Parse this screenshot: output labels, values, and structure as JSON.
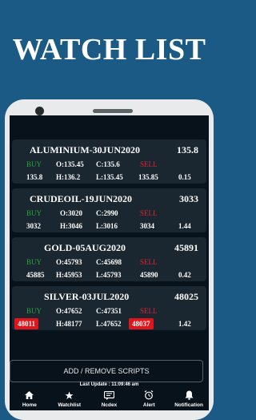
{
  "banner_title": "WATCH LIST",
  "scripts": [
    {
      "name": "ALUMINIUM-30JUN2020",
      "price": "135.8",
      "buy": "BUY",
      "sell": "SELL",
      "open": "O:135.45",
      "close": "C:135.6",
      "bid": "135.8",
      "high": "H:136.2",
      "low": "L:135.45",
      "ask": "135.85",
      "change": "0.15",
      "bid_highlight": false,
      "ask_highlight": false
    },
    {
      "name": "CRUDEOIL-19JUN2020",
      "price": "3033",
      "buy": "BUY",
      "sell": "SELL",
      "open": "O:3020",
      "close": "C:2990",
      "bid": "3032",
      "high": "H:3046",
      "low": "L:3016",
      "ask": "3034",
      "change": "1.44",
      "bid_highlight": false,
      "ask_highlight": false
    },
    {
      "name": "GOLD-05AUG2020",
      "price": "45891",
      "buy": "BUY",
      "sell": "SELL",
      "open": "O:45793",
      "close": "C:45698",
      "bid": "45885",
      "high": "H:45953",
      "low": "L:45793",
      "ask": "45890",
      "change": "0.42",
      "bid_highlight": false,
      "ask_highlight": false
    },
    {
      "name": "SILVER-03JUL2020",
      "price": "48025",
      "buy": "BUY",
      "sell": "SELL",
      "open": "O:47652",
      "close": "C:47351",
      "bid": "48011",
      "high": "H:48177",
      "low": "L:47652",
      "ask": "48037",
      "change": "1.42",
      "bid_highlight": true,
      "ask_highlight": true
    }
  ],
  "add_remove_label": "ADD / REMOVE SCRIPTS",
  "last_update": "Last Update : 11:09:46 am",
  "tabs": [
    {
      "label": "Home",
      "icon": "home-icon"
    },
    {
      "label": "Watchlist",
      "icon": "star-icon"
    },
    {
      "label": "Ncdex",
      "icon": "chat-icon"
    },
    {
      "label": "Alert",
      "icon": "alarm-icon"
    },
    {
      "label": "Notification",
      "icon": "bell-icon"
    }
  ],
  "colors": {
    "background": "#1a5a84",
    "card": "#1a2630",
    "buy": "#24a93a",
    "sell": "#e0262b",
    "highlight": "#e0151c"
  }
}
